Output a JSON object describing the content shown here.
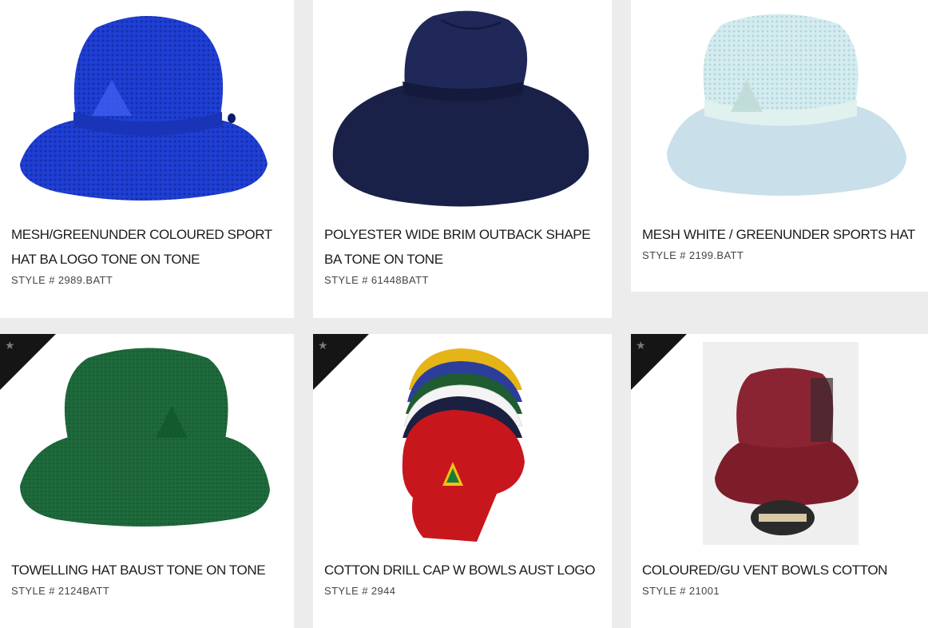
{
  "products": [
    {
      "title": "MESH/GREENUNDER COLOURED SPORT HAT BA LOGO TONE ON TONE",
      "style": "STYLE # 2989.BATT",
      "featured": false,
      "image": "blue-mesh-bucket-hat"
    },
    {
      "title": "POLYESTER WIDE BRIM OUTBACK SHAPE BA TONE ON TONE",
      "style": "STYLE # 61448BATT",
      "featured": false,
      "image": "navy-wide-brim-hat"
    },
    {
      "title": "MESH WHITE / GREENUNDER SPORTS HAT",
      "style": "STYLE # 2199.BATT",
      "featured": false,
      "image": "white-mesh-bucket-hat"
    },
    {
      "title": "TOWELLING HAT BAUST TONE ON TONE",
      "style": "STYLE # 2124BATT",
      "featured": true,
      "image": "green-towelling-bucket-hat"
    },
    {
      "title": "COTTON DRILL CAP W BOWLS AUST LOGO",
      "style": "STYLE # 2944",
      "featured": true,
      "image": "stacked-caps"
    },
    {
      "title": "COLOURED/GU VENT BOWLS COTTON",
      "style": "STYLE # 21001",
      "featured": true,
      "image": "maroon-vent-bucket-hat"
    }
  ],
  "badge_icon": "star-icon",
  "colors": {
    "background": "#ececec",
    "card": "#ffffff",
    "badge": "#151515",
    "text": "#1c1c1c"
  }
}
